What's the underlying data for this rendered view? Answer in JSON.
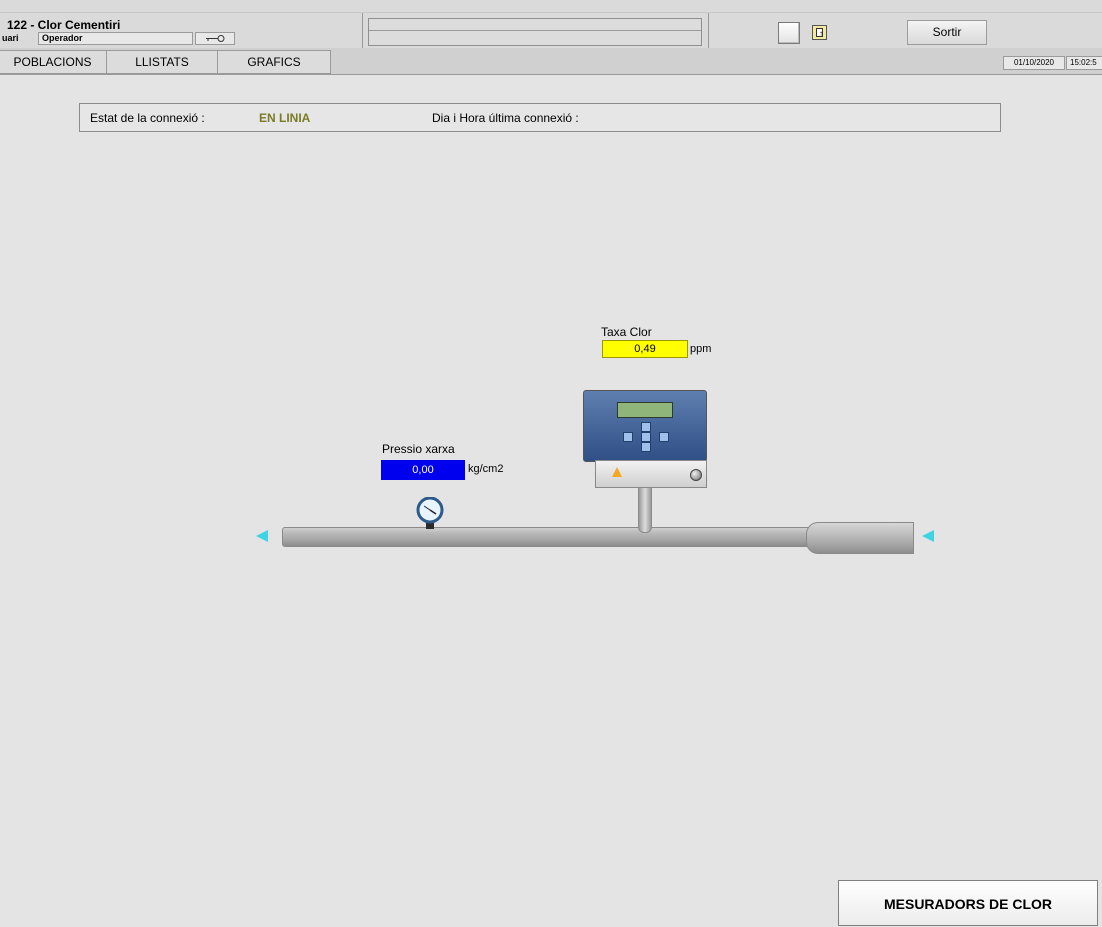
{
  "header": {
    "title": "122 - Clor Cementiri",
    "user_label": "uari",
    "user_value": "Operador",
    "sortir_label": "Sortir"
  },
  "menu": {
    "items": [
      "POBLACIONS",
      "LLISTATS",
      "GRAFICS"
    ],
    "date": "01/10/2020",
    "time": "15:02:5"
  },
  "connection": {
    "status_label": "Estat de la connexió :",
    "status_value": "EN LINIA",
    "last_label": "Dia i Hora última connexió :"
  },
  "readings": {
    "taxa_clor": {
      "label": "Taxa Clor",
      "value": "0,49",
      "unit": "ppm",
      "color": "#ffff00"
    },
    "pressio_xarxa": {
      "label": "Pressio xarxa",
      "value": "0,00",
      "unit": "kg/cm2",
      "color": "#0000ee"
    }
  },
  "icons": {
    "key": "key-icon",
    "export": "export-icon",
    "flow_left": "flow-arrow-left-icon",
    "flow_right": "flow-arrow-right-icon",
    "gauge": "pressure-gauge-icon",
    "analyzer": "chlorine-analyzer-icon"
  },
  "colors": {
    "online": "#7b7b25",
    "arrow": "#3fd3e6"
  },
  "footer": {
    "mesuradors_label": "MESURADORS DE CLOR"
  }
}
